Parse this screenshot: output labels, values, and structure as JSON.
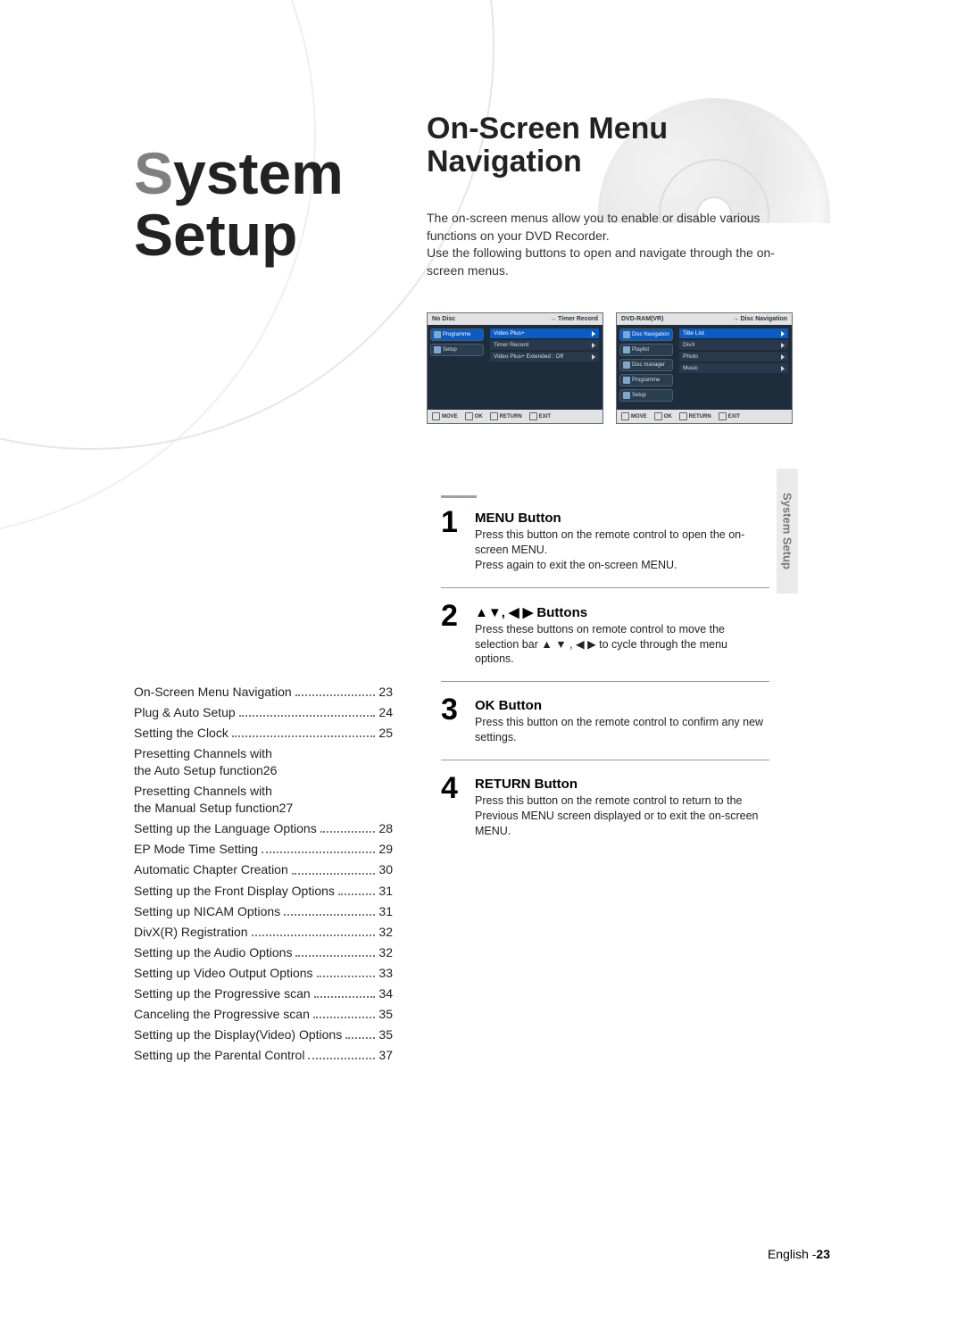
{
  "chapter": {
    "accent": "S",
    "rest": "ystem",
    "line2": "Setup"
  },
  "section_title": {
    "line1": "On-Screen Menu",
    "line2": "Navigation"
  },
  "intro": {
    "p1": "The on-screen menus allow you to enable or disable various functions on your DVD Recorder.",
    "p2": "Use the following buttons to open and navigate through the on-screen menus."
  },
  "osd": {
    "left": {
      "top_left": "No Disc",
      "top_right_arrow": "→",
      "top_right": "Timer Record",
      "side": [
        {
          "label": "Programme",
          "selected": true
        },
        {
          "label": "Setup",
          "selected": false
        }
      ],
      "menu": [
        {
          "label": "Video Plus+",
          "selected": true
        },
        {
          "label": "Timer Record",
          "selected": false
        },
        {
          "label": "Video Plus+ Extended : Off",
          "selected": false
        }
      ],
      "footer": {
        "move": "MOVE",
        "ok": "OK",
        "return": "RETURN",
        "exit": "EXIT"
      }
    },
    "right": {
      "top_left": "DVD-RAM(VR)",
      "top_right_arrow": "→",
      "top_right": "Disc Navigation",
      "side": [
        {
          "label": "Disc Navigation",
          "selected": true
        },
        {
          "label": "Playlist",
          "selected": false
        },
        {
          "label": "Disc manager",
          "selected": false
        },
        {
          "label": "Programme",
          "selected": false
        },
        {
          "label": "Setup",
          "selected": false
        }
      ],
      "menu": [
        {
          "label": "Title List",
          "selected": true
        },
        {
          "label": "DivX",
          "selected": false
        },
        {
          "label": "Photo",
          "selected": false
        },
        {
          "label": "Music",
          "selected": false
        }
      ],
      "footer": {
        "move": "MOVE",
        "ok": "OK",
        "return": "RETURN",
        "exit": "EXIT"
      }
    }
  },
  "sidetab": "System Setup",
  "steps": [
    {
      "num": "1",
      "title": "MENU Button",
      "body_lines": [
        "Press this button on the remote control to open the on-screen MENU.",
        "Press again to exit the on-screen MENU."
      ]
    },
    {
      "num": "2",
      "title": "▲▼, ◀ ▶ Buttons",
      "body_lines": [
        "Press these buttons on remote control to move the selection bar ▲ ▼ , ◀ ▶ to cycle through the menu options."
      ]
    },
    {
      "num": "3",
      "title": "OK Button",
      "body_lines": [
        "Press this button on the remote control to confirm any new settings."
      ]
    },
    {
      "num": "4",
      "title": "RETURN Button",
      "body_lines": [
        "Press this button on the remote control to return to the Previous MENU screen displayed or to exit the on-screen MENU."
      ]
    }
  ],
  "toc": [
    {
      "title": "On-Screen Menu Navigation",
      "page": "23"
    },
    {
      "title": "Plug & Auto Setup",
      "page": "24"
    },
    {
      "title": "Setting the Clock",
      "page": "25"
    },
    {
      "group": true,
      "lead": "Presetting Channels with",
      "cont": "the Auto Setup function",
      "page": "26"
    },
    {
      "group": true,
      "lead": "Presetting Channels with",
      "cont": "the Manual Setup function",
      "page": "27"
    },
    {
      "title": "Setting up the Language Options",
      "page": "28"
    },
    {
      "title": "EP Mode Time Setting",
      "page": "29"
    },
    {
      "title": "Automatic Chapter Creation",
      "page": "30"
    },
    {
      "title": "Setting up the Front Display Options",
      "page": "31"
    },
    {
      "title": "Setting up NICAM Options",
      "page": "31"
    },
    {
      "title": "DivX(R) Registration",
      "page": "32"
    },
    {
      "title": "Setting up the Audio Options",
      "page": "32"
    },
    {
      "title": "Setting up Video Output Options",
      "page": "33"
    },
    {
      "title": "Setting up the Progressive scan",
      "page": "34"
    },
    {
      "title": "Canceling the Progressive scan",
      "page": "35"
    },
    {
      "title": "Setting up the Display(Video) Options",
      "page": "35"
    },
    {
      "title": "Setting up the Parental Control",
      "page": "37"
    }
  ],
  "footer": {
    "lang": "English -",
    "page": "23"
  }
}
